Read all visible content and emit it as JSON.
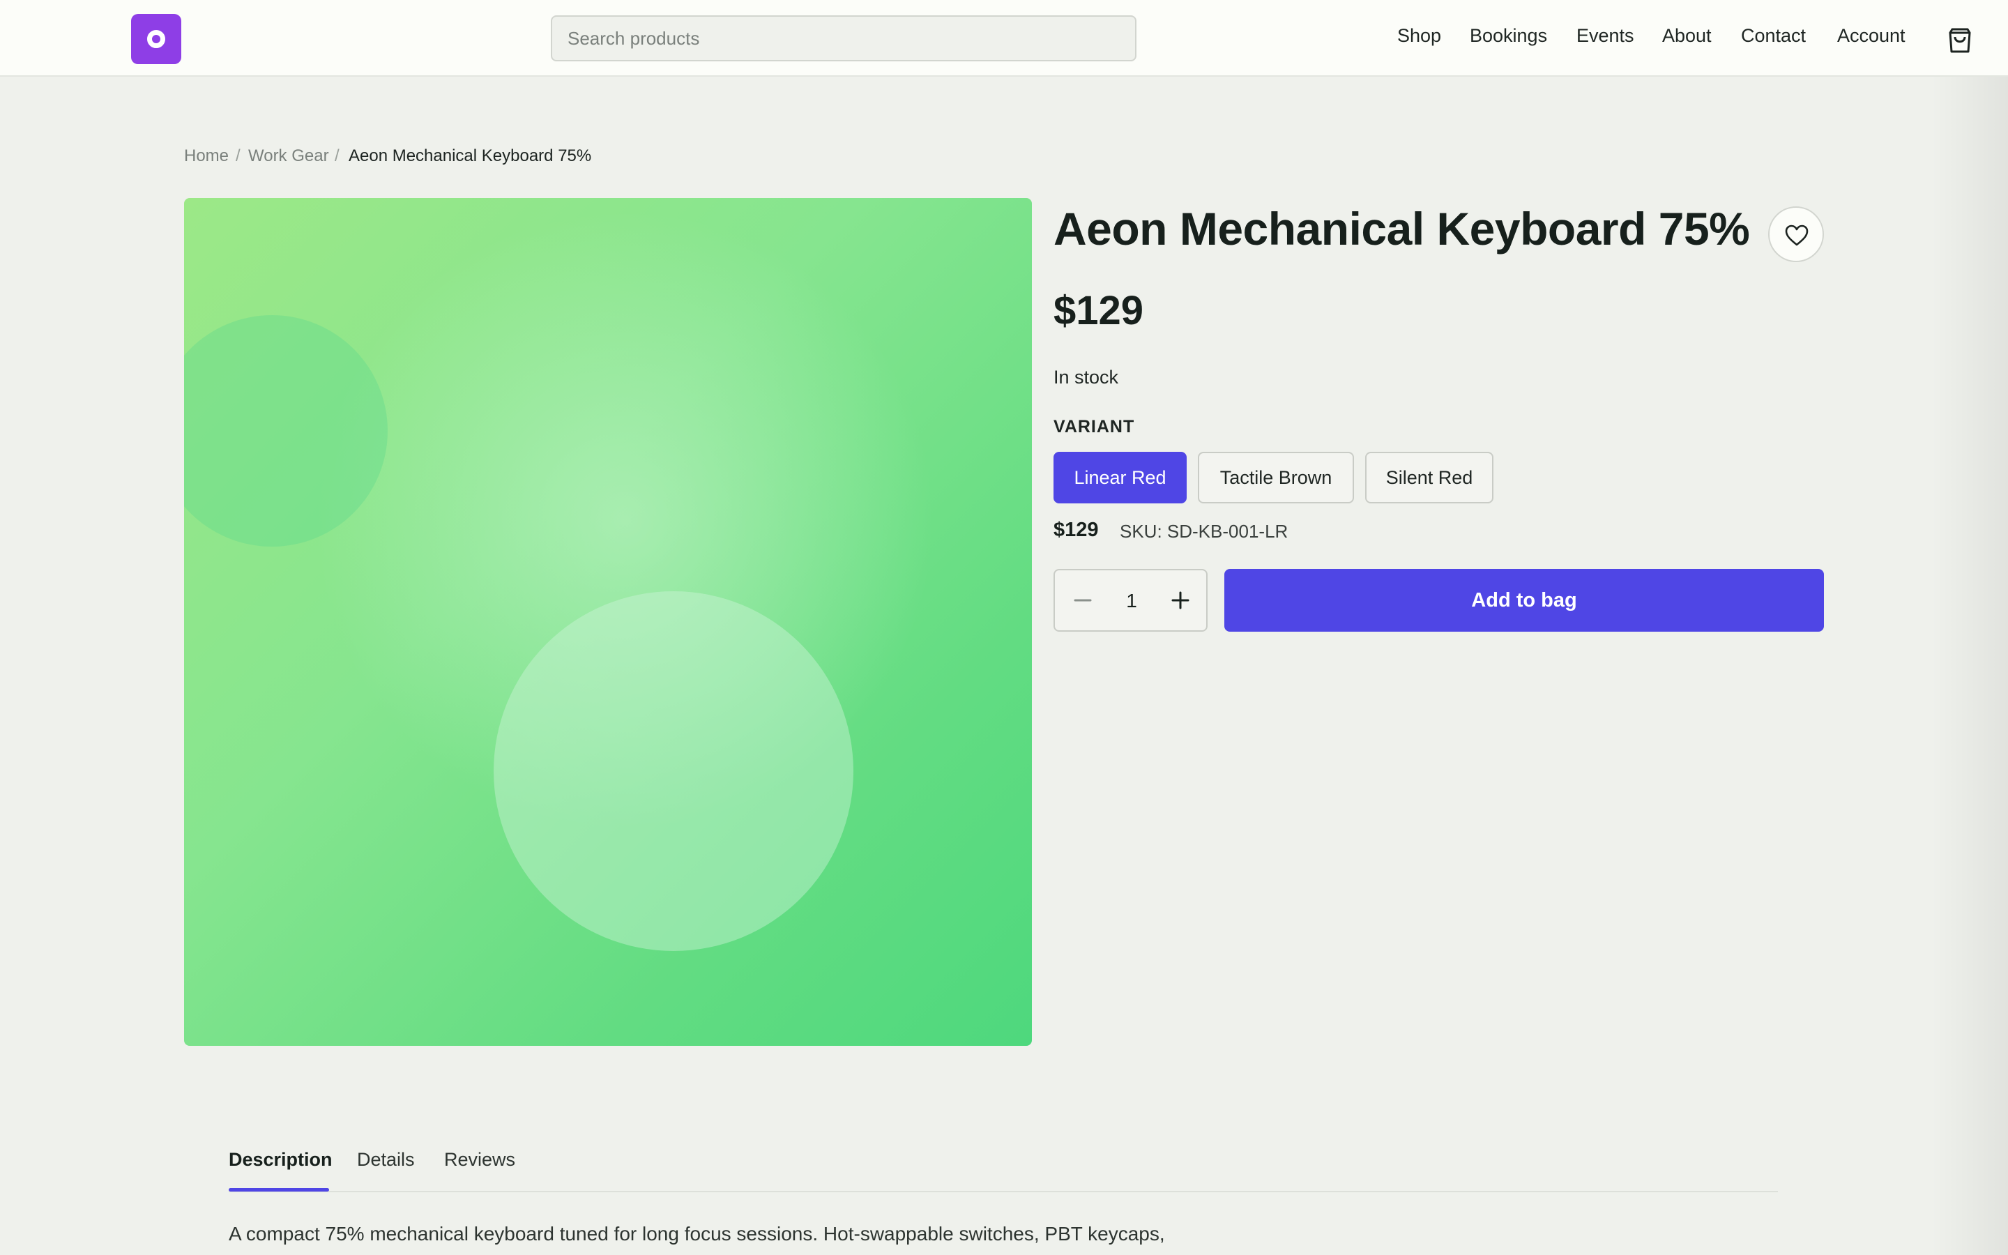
{
  "header": {
    "search": {
      "placeholder": "Search products",
      "value": ""
    },
    "nav": [
      {
        "label": "Shop"
      },
      {
        "label": "Bookings"
      },
      {
        "label": "Events"
      },
      {
        "label": "About"
      },
      {
        "label": "Contact"
      },
      {
        "label": "Account"
      }
    ],
    "brand_color": "#8e3ee6"
  },
  "breadcrumb": {
    "items": [
      {
        "label": "Home"
      },
      {
        "label": "Work Gear"
      }
    ],
    "separator": "/",
    "current": "Aeon Mechanical Keyboard 75%"
  },
  "product": {
    "title": "Aeon Mechanical Keyboard 75%",
    "price": "$129",
    "stock": "In stock",
    "variant_label": "VARIANT",
    "variants": [
      {
        "label": "Linear Red",
        "selected": true
      },
      {
        "label": "Tactile Brown",
        "selected": false
      },
      {
        "label": "Silent Red",
        "selected": false
      }
    ],
    "selected_price": "$129",
    "sku": "SKU: SD-KB-001-LR",
    "quantity": "1",
    "add_to_bag_label": "Add to bag",
    "accent_color": "#4f46e5"
  },
  "tabs": [
    {
      "label": "Description",
      "active": true
    },
    {
      "label": "Details",
      "active": false
    },
    {
      "label": "Reviews",
      "active": false
    }
  ],
  "description": "A compact 75% mechanical keyboard tuned for long focus sessions. Hot-swappable switches, PBT keycaps,",
  "icons": {
    "logo": "logo-icon",
    "bag": "shopping-bag-icon",
    "favorite": "heart-icon",
    "decrement": "minus-icon",
    "increment": "plus-icon"
  }
}
